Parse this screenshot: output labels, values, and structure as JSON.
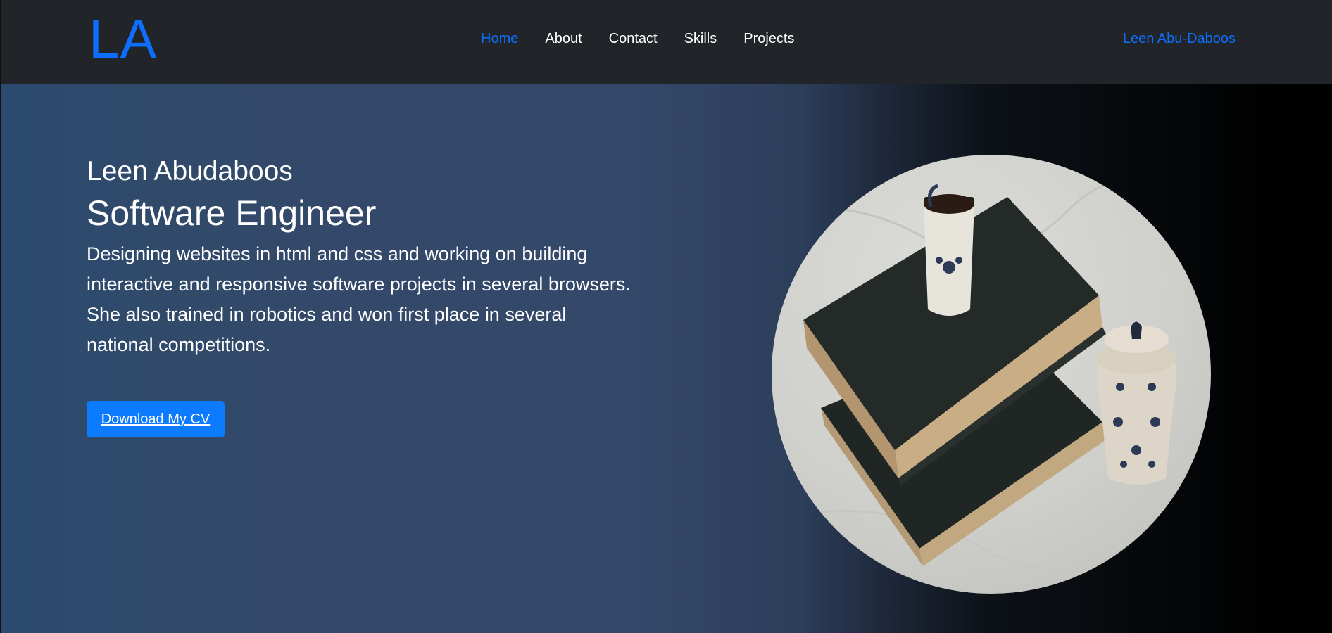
{
  "navbar": {
    "logo": "LA",
    "links": [
      "Home",
      "About",
      "Contact",
      "Skills",
      "Projects"
    ],
    "active_index": 0,
    "brand_name": "Leen Abu-Daboos"
  },
  "hero": {
    "name": "Leen Abudaboos",
    "title": "Software Engineer",
    "description": "Designing websites in html and css and working on building interactive and responsive software projects in several browsers. She also trained in robotics and won first place in several national competitions.",
    "cv_button": "Download My CV",
    "image": "books-with-coffee-cup-and-jar-photo"
  },
  "colors": {
    "accent": "#0d6efd",
    "button": "#0d7bfd",
    "navbar_bg": "#212529"
  }
}
